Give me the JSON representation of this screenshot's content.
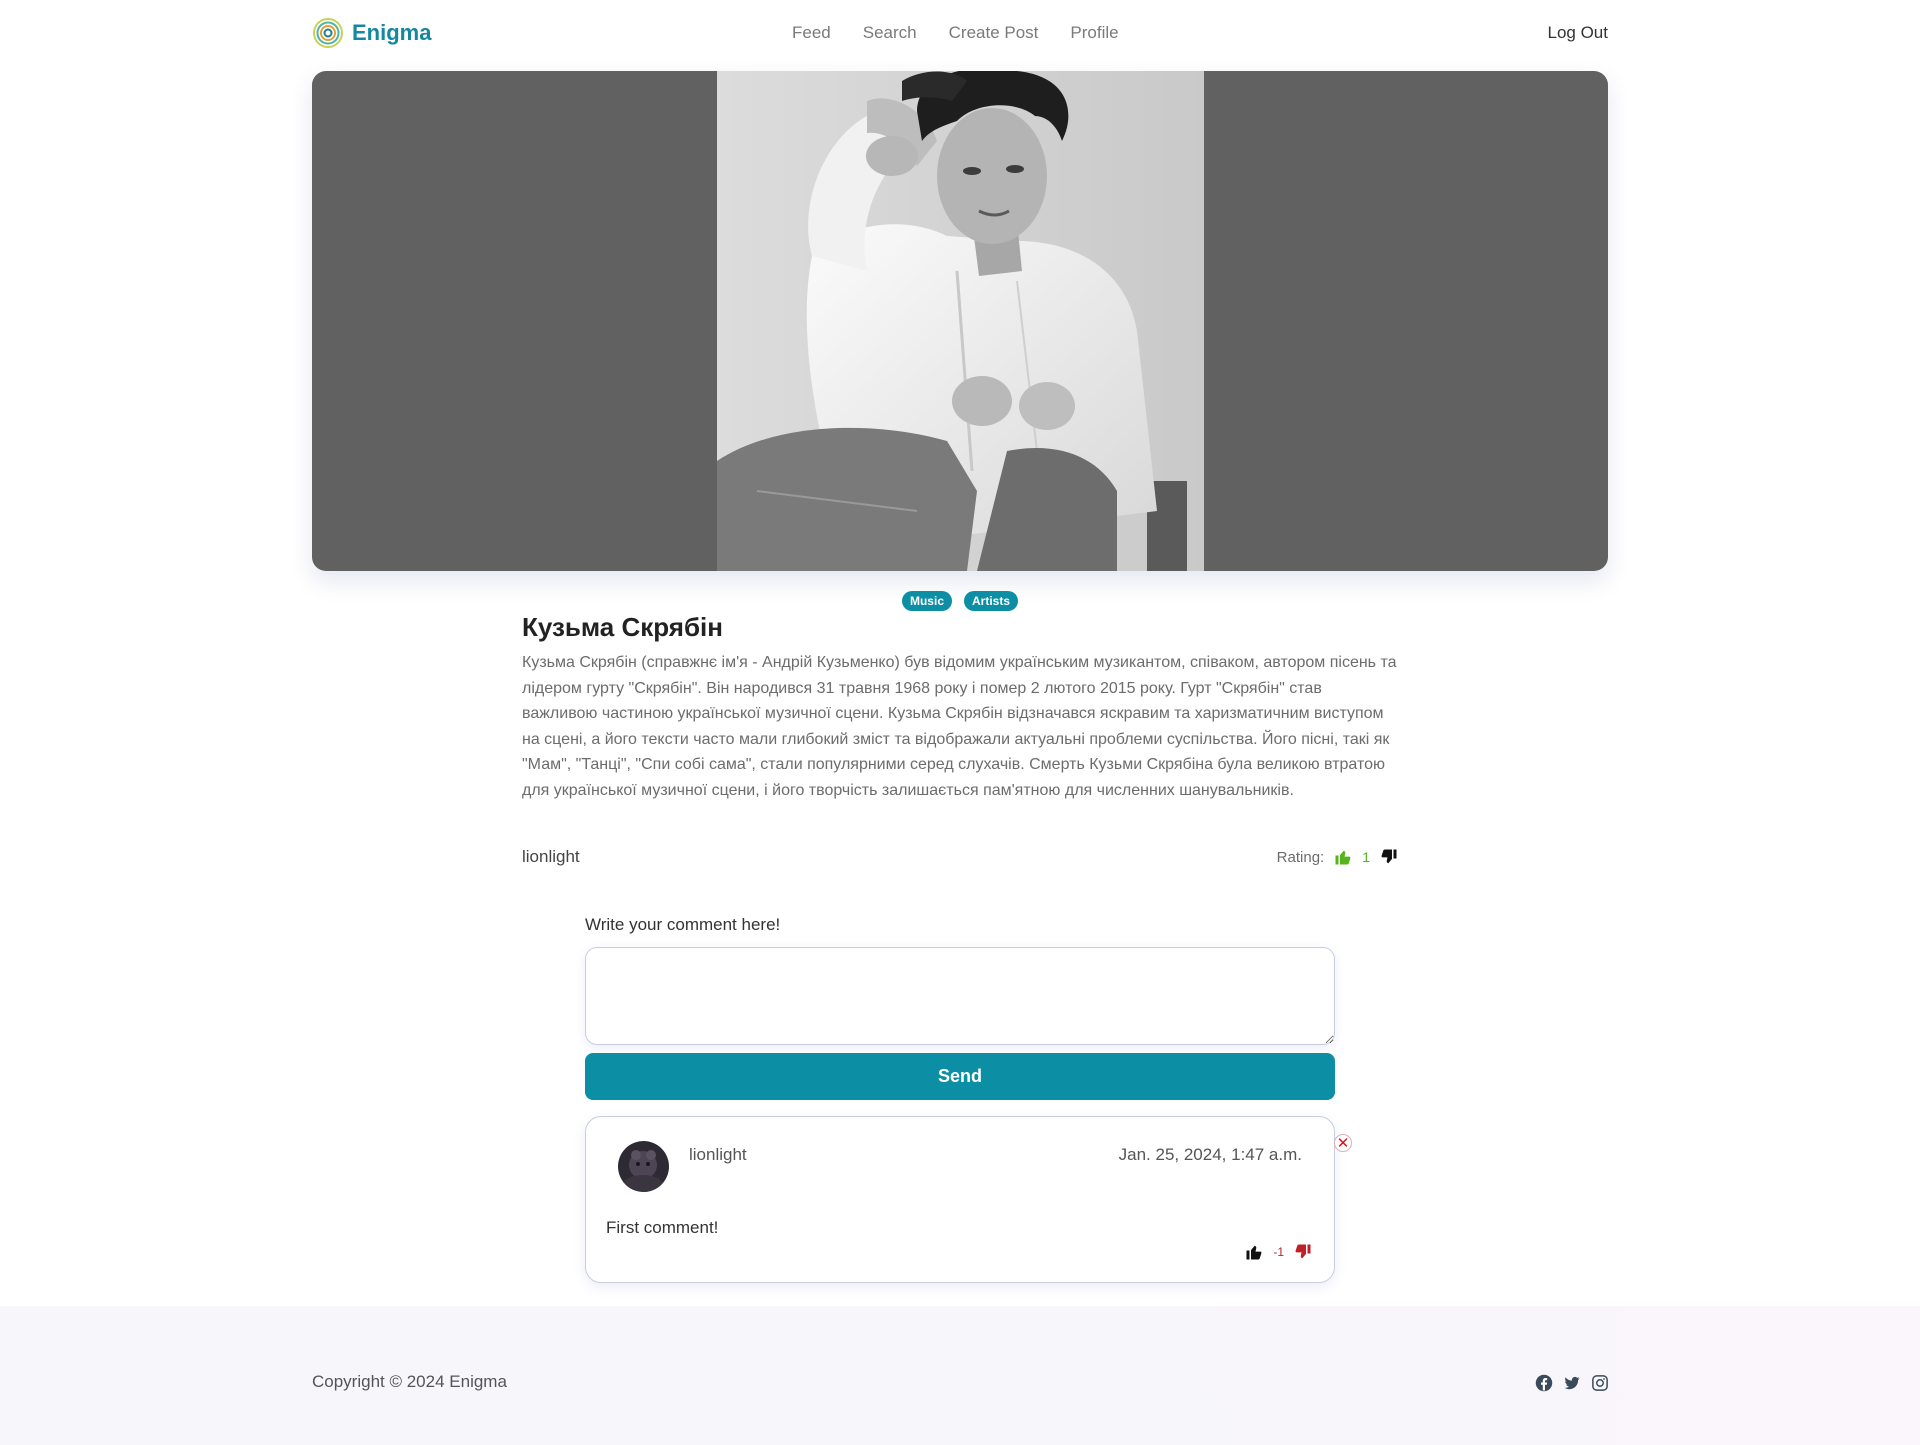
{
  "header": {
    "brand": "Enigma",
    "nav": [
      "Feed",
      "Search",
      "Create Post",
      "Profile"
    ],
    "logout": "Log Out"
  },
  "post": {
    "tags": [
      "Music",
      "Artists"
    ],
    "title": "Кузьма Скрябін",
    "body": "Кузьма Скрябін (справжнє ім'я - Андрій Кузьменко) був відомим українським музикантом, співаком, автором пісень та лідером гурту \"Скрябін\". Він народився 31 травня 1968 року і помер 2 лютого 2015 року. Гурт \"Скрябін\" став важливою частиною української музичної сцени. Кузьма Скрябін відзначався яскравим та харизматичним виступом на сцені, а його тексти часто мали глибокий зміст та відображали актуальні проблеми суспільства. Його пісні, такі як \"Мам\", \"Танці\", \"Спи собі сама\", стали популярними серед слухачів. Смерть Кузьми Скрябіна була великою втратою для української музичної сцени, і його творчість залишається пам'ятною для численних шанувальників.",
    "author": "lionlight",
    "rating_label": "Rating:",
    "rating": "1"
  },
  "comment_form": {
    "label": "Write your comment here!",
    "value": "",
    "send": "Send"
  },
  "comments": [
    {
      "author": "lionlight",
      "date": "Jan. 25, 2024, 1:47 a.m.",
      "text": "First comment!",
      "votes": "-1",
      "delete": "✕"
    }
  ],
  "footer": {
    "copyright": "Copyright © 2024 Enigma",
    "socials": [
      "facebook-icon",
      "twitter-icon",
      "instagram-icon"
    ]
  },
  "colors": {
    "accent": "#0c8ea5",
    "brand": "#1488a1",
    "like": "#55b51a",
    "dislike": "#b3262a"
  }
}
